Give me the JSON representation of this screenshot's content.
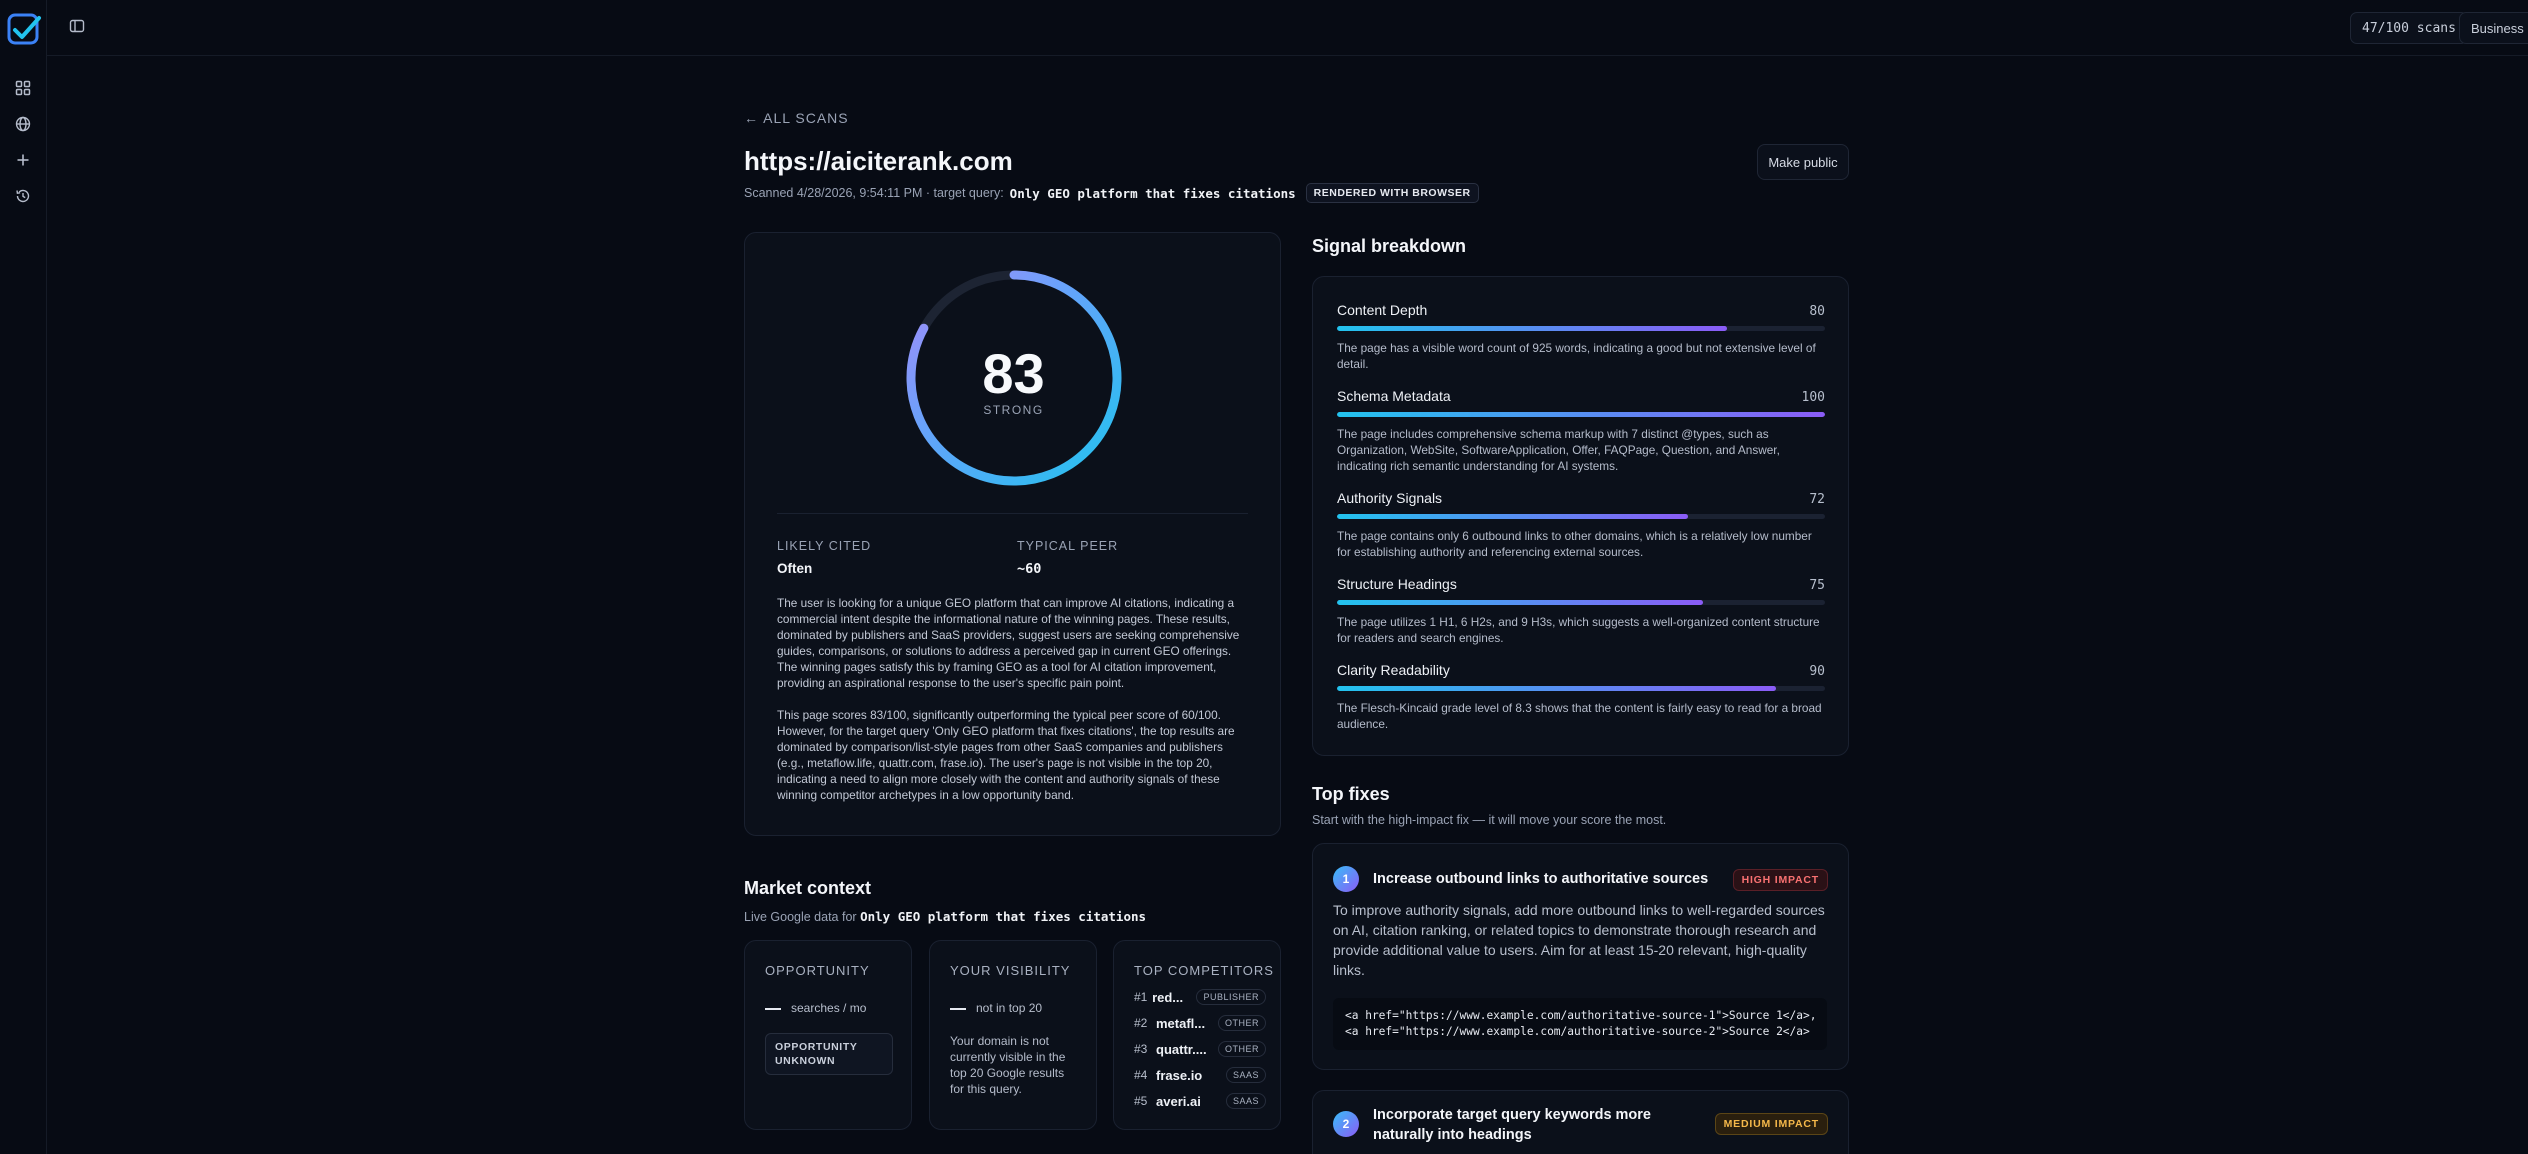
{
  "app": {
    "brand_color": "#3b82f6"
  },
  "rail": {
    "icons": [
      "dashboard-icon",
      "globe-icon",
      "plus-icon",
      "history-icon"
    ]
  },
  "topbar": {
    "scans_label": "47/100 scans",
    "plan_label": "Business"
  },
  "header": {
    "back_label": "← ALL SCANS",
    "title": "https://aiciterank.com",
    "scanned_prefix": "Scanned 4/28/2026, 9:54:11 PM · target query:",
    "target_query": "Only GEO platform that fixes citations",
    "render_badge": "RENDERED WITH BROWSER",
    "make_public_label": "Make public"
  },
  "score": {
    "value": "83",
    "max": 100,
    "label": "STRONG",
    "likely_cited_label": "LIKELY CITED",
    "likely_cited_value": "Often",
    "typical_peer_label": "TYPICAL PEER",
    "typical_peer_value": "~60",
    "summary_1": "The user is looking for a unique GEO platform that can improve AI citations, indicating a commercial intent despite the informational nature of the winning pages. These results, dominated by publishers and SaaS providers, suggest users are seeking comprehensive guides, comparisons, or solutions to address a perceived gap in current GEO offerings. The winning pages satisfy this by framing GEO as a tool for AI citation improvement, providing an aspirational response to the user's specific pain point.",
    "summary_2": "This page scores 83/100, significantly outperforming the typical peer score of 60/100. However, for the target query 'Only GEO platform that fixes citations', the top results are dominated by comparison/list-style pages from other SaaS companies and publishers (e.g., metaflow.life, quattr.com, frase.io). The user's page is not visible in the top 20, indicating a need to align more closely with the content and authority signals of these winning competitor archetypes in a low opportunity band."
  },
  "signals": {
    "heading": "Signal breakdown",
    "items": [
      {
        "name": "Content Depth",
        "score": "80",
        "value": 80,
        "desc": "The page has a visible word count of 925 words, indicating a good but not extensive level of detail."
      },
      {
        "name": "Schema Metadata",
        "score": "100",
        "value": 100,
        "desc": "The page includes comprehensive schema markup with 7 distinct @types, such as Organization, WebSite, SoftwareApplication, Offer, FAQPage, Question, and Answer, indicating rich semantic understanding for AI systems."
      },
      {
        "name": "Authority Signals",
        "score": "72",
        "value": 72,
        "desc": "The page contains only 6 outbound links to other domains, which is a relatively low number for establishing authority and referencing external sources."
      },
      {
        "name": "Structure Headings",
        "score": "75",
        "value": 75,
        "desc": "The page utilizes 1 H1, 6 H2s, and 9 H3s, which suggests a well-organized content structure for readers and search engines."
      },
      {
        "name": "Clarity Readability",
        "score": "90",
        "value": 90,
        "desc": "The Flesch-Kincaid grade level of 8.3 shows that the content is fairly easy to read for a broad audience."
      }
    ]
  },
  "fixes": {
    "heading": "Top fixes",
    "subtitle": "Start with the high-impact fix — it will move your score the most.",
    "items": [
      {
        "num": "1",
        "title": "Increase outbound links to authoritative sources",
        "impact": "HIGH IMPACT",
        "body": "To improve authority signals, add more outbound links to well-regarded sources on AI, citation ranking, or related topics to demonstrate thorough research and provide additional value to users. Aim for at least 15-20 relevant, high-quality links.",
        "code": "<a href=\"https://www.example.com/authoritative-source-1\">Source 1</a>,\n<a href=\"https://www.example.com/authoritative-source-2\">Source 2</a>"
      },
      {
        "num": "2",
        "title": "Incorporate target query keywords more naturally into headings",
        "impact": "MEDIUM IMPACT"
      }
    ]
  },
  "market": {
    "heading": "Market context",
    "subtitle_prefix": "Live Google data for",
    "query": "Only GEO platform that fixes citations",
    "opportunity": {
      "title": "OPPORTUNITY",
      "line": "searches / mo",
      "badge": "OPPORTUNITY UNKNOWN"
    },
    "visibility": {
      "title": "YOUR VISIBILITY",
      "line": "not in top 20",
      "desc": "Your domain is not currently visible in the top 20 Google results for this query."
    },
    "competitors": {
      "title": "TOP COMPETITORS",
      "items": [
        {
          "rank": "#1",
          "name": "red...",
          "tag": "PUBLISHER"
        },
        {
          "rank": "#2",
          "name": "metafl...",
          "tag": "OTHER"
        },
        {
          "rank": "#3",
          "name": "quattr....",
          "tag": "OTHER"
        },
        {
          "rank": "#4",
          "name": "frase.io",
          "tag": "SAAS"
        },
        {
          "rank": "#5",
          "name": "averi.ai",
          "tag": "SAAS"
        }
      ]
    }
  }
}
